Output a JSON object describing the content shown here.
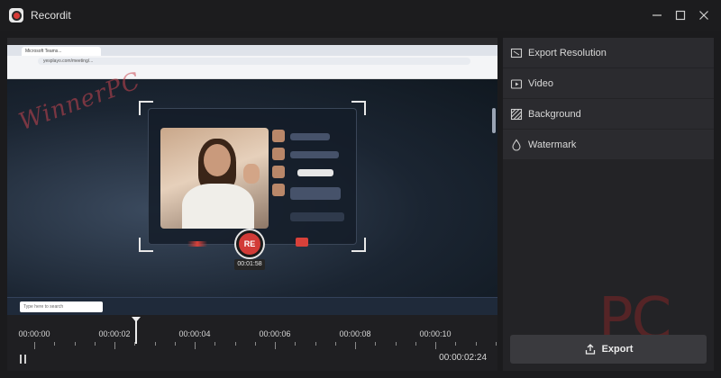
{
  "window": {
    "title": "Recordit",
    "logo_icon": "recordit-logo-icon",
    "controls": [
      "minimize-icon",
      "maximize-icon",
      "close-icon"
    ]
  },
  "preview": {
    "recorded_content": {
      "browser_tab_label": "Microsoft Teams...",
      "url": "yesplayo.com/meeting/...",
      "watermark_text": "WinnerPC",
      "taskbar_search_placeholder": "Type here to search",
      "recording_badge": "RE",
      "recording_timer": "00:01:58"
    }
  },
  "timeline": {
    "ticks": [
      "00:00:00",
      "00:00:02",
      "00:00:04",
      "00:00:06",
      "00:00:08",
      "00:00:10"
    ],
    "playhead_time": "00:00:02",
    "current_time": "00:00:02:24",
    "play_state_icon": "pause-icon"
  },
  "side_panel": {
    "items": [
      {
        "label": "Export Resolution",
        "icon": "resolution-icon"
      },
      {
        "label": "Video",
        "icon": "video-icon"
      },
      {
        "label": "Background",
        "icon": "background-icon"
      },
      {
        "label": "Watermark",
        "icon": "watermark-icon"
      }
    ],
    "export_label": "Export",
    "export_icon": "export-icon",
    "brand_mark": "PC"
  },
  "colors": {
    "accent_red": "#d23b37",
    "panel_bg": "#232326",
    "row_bg": "#2b2b2f",
    "app_bg": "#1b1b1d"
  }
}
